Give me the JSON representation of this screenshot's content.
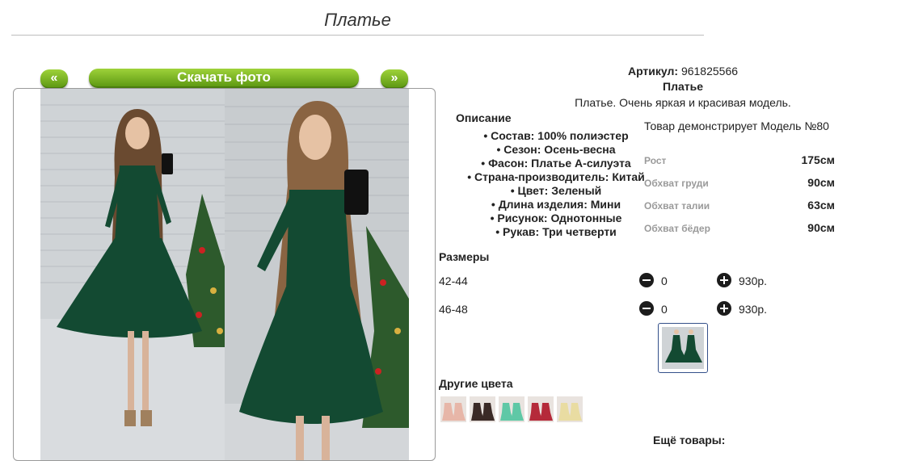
{
  "page": {
    "title": "Платье"
  },
  "gallery": {
    "prev_label": "«",
    "next_label": "»",
    "download_label": "Скачать фото"
  },
  "product": {
    "article_label": "Артикул:",
    "article_value": "961825566",
    "name": "Платье",
    "short_desc": "Платье. Очень яркая и красивая модель."
  },
  "description": {
    "title": "Описание",
    "items": [
      "Состав: 100% полиэстер",
      "Сезон: Осень-весна",
      "Фасон: Платье А-силуэта",
      "Страна-производитель: Китай",
      "Цвет: Зеленый",
      "Длина изделия: Мини",
      "Рисунок: Однотонные",
      "Рукав: Три четверти"
    ]
  },
  "model": {
    "title": "Товар демонстрирует Модель №80",
    "measurements": [
      {
        "label": "Рост",
        "value": "175см"
      },
      {
        "label": "Обхват груди",
        "value": "90см"
      },
      {
        "label": "Обхват талии",
        "value": "63см"
      },
      {
        "label": "Обхват бёдер",
        "value": "90см"
      }
    ]
  },
  "sizes": {
    "title": "Размеры",
    "rows": [
      {
        "size": "42-44",
        "qty": "0",
        "price": "930р."
      },
      {
        "size": "46-48",
        "qty": "0",
        "price": "930р."
      }
    ]
  },
  "other_colors": {
    "title": "Другие цвета",
    "swatches": [
      "#e7b6a8",
      "#3a2a26",
      "#5fc8a6",
      "#b52a3a",
      "#e9dca2"
    ]
  },
  "more": {
    "title": "Ещё товары:"
  },
  "colors": {
    "accent_green": "#7bbd26",
    "dress_green": "#134a32",
    "thumb_border": "#34508a"
  }
}
